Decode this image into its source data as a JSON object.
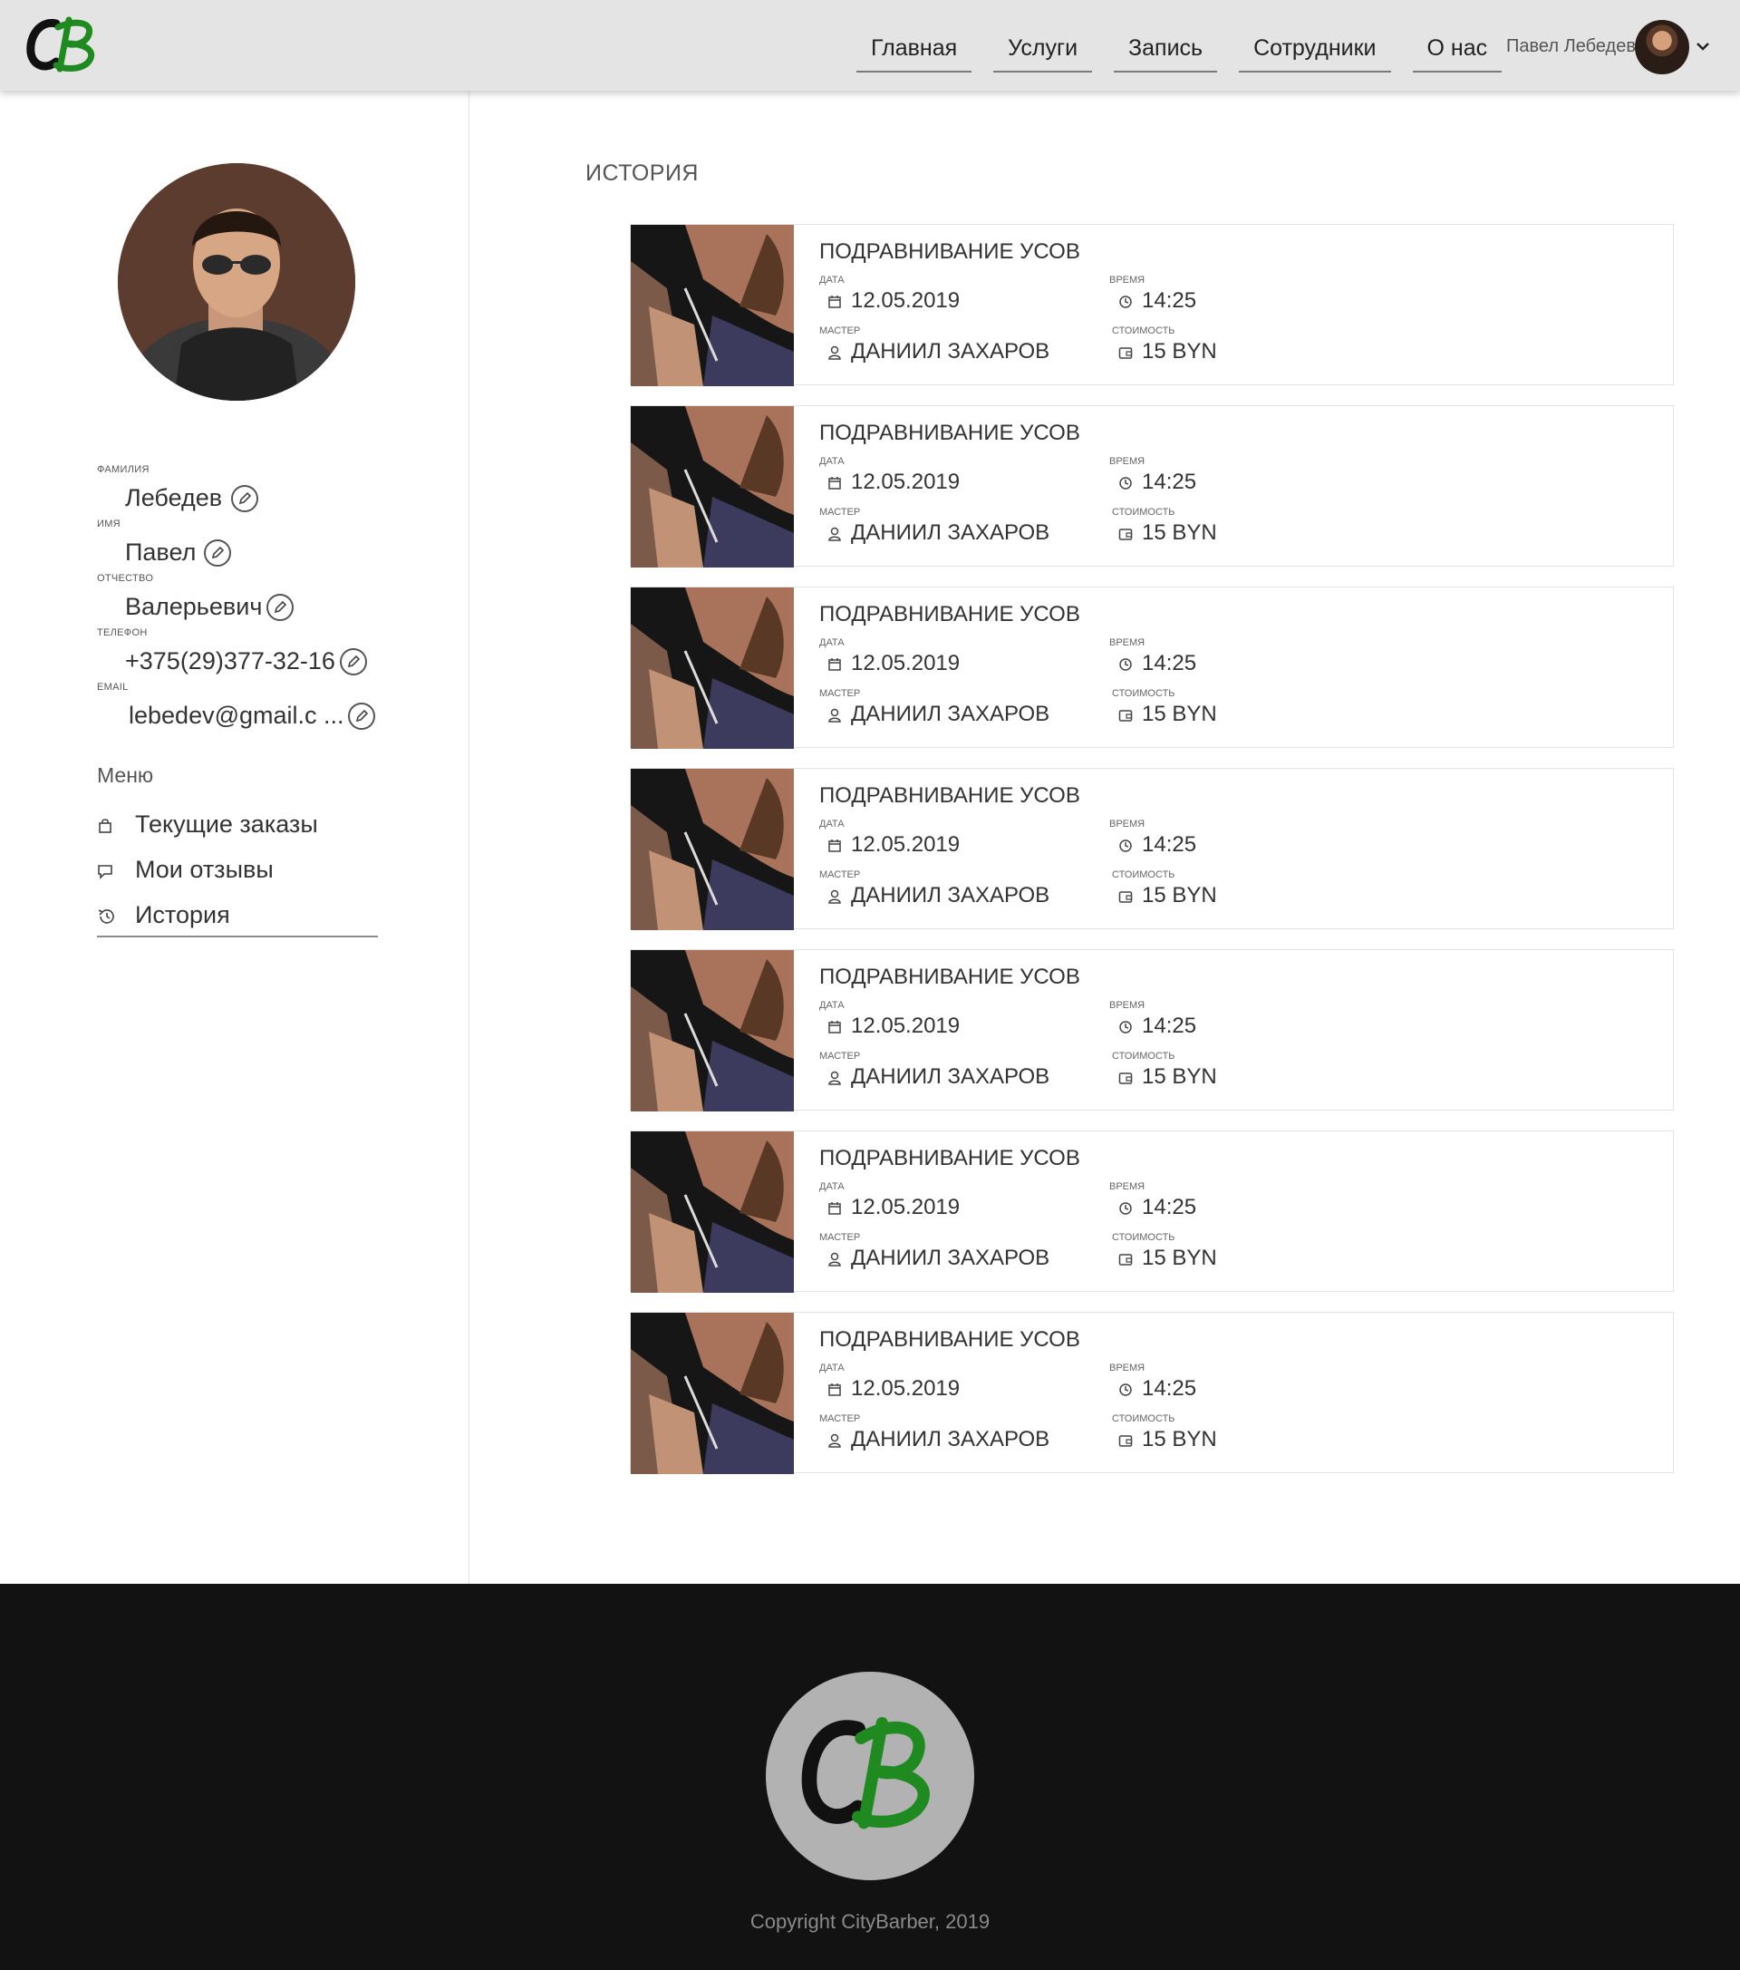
{
  "header": {
    "logo_text": "CB",
    "nav": [
      "Главная",
      "Услуги",
      "Запись",
      "Сотрудники",
      "О нас"
    ],
    "user_name": "Павел Лебедев"
  },
  "profile": {
    "fields": [
      {
        "label": "Фамилия",
        "value": "Лебедев"
      },
      {
        "label": "Имя",
        "value": "Павел"
      },
      {
        "label": "Отчество",
        "value": "Валерьевич"
      },
      {
        "label": "Телефон",
        "value": "+375(29)377-32-16"
      },
      {
        "label": "Email",
        "value": "lebedev@gmail.c ..."
      }
    ],
    "menu_title": "Меню",
    "menu": [
      {
        "label": "Текущие заказы",
        "icon": "bag-icon"
      },
      {
        "label": "Мои отзывы",
        "icon": "comment-icon"
      },
      {
        "label": "История",
        "icon": "history-icon"
      }
    ]
  },
  "history": {
    "title": "ИСТОРИЯ",
    "labels": {
      "date": "ДАТА",
      "time": "ВРЕМЯ",
      "master": "МАСТЕР",
      "price": "СТОИМОСТЬ"
    },
    "orders": [
      {
        "service": "ПОДРАВНИВАНИЕ УСОВ",
        "date": "12.05.2019",
        "time": "14:25",
        "master": "ДАНИИЛ ЗАХАРОВ",
        "price": "15 BYN"
      },
      {
        "service": "ПОДРАВНИВАНИЕ УСОВ",
        "date": "12.05.2019",
        "time": "14:25",
        "master": "ДАНИИЛ ЗАХАРОВ",
        "price": "15 BYN"
      },
      {
        "service": "ПОДРАВНИВАНИЕ УСОВ",
        "date": "12.05.2019",
        "time": "14:25",
        "master": "ДАНИИЛ ЗАХАРОВ",
        "price": "15 BYN"
      },
      {
        "service": "ПОДРАВНИВАНИЕ УСОВ",
        "date": "12.05.2019",
        "time": "14:25",
        "master": "ДАНИИЛ ЗАХАРОВ",
        "price": "15 BYN"
      },
      {
        "service": "ПОДРАВНИВАНИЕ УСОВ",
        "date": "12.05.2019",
        "time": "14:25",
        "master": "ДАНИИЛ ЗАХАРОВ",
        "price": "15 BYN"
      },
      {
        "service": "ПОДРАВНИВАНИЕ УСОВ",
        "date": "12.05.2019",
        "time": "14:25",
        "master": "ДАНИИЛ ЗАХАРОВ",
        "price": "15 BYN"
      },
      {
        "service": "ПОДРАВНИВАНИЕ УСОВ",
        "date": "12.05.2019",
        "time": "14:25",
        "master": "ДАНИИЛ ЗАХАРОВ",
        "price": "15 BYN"
      }
    ]
  },
  "footer": {
    "copyright": "Copyright CityBarber, 2019"
  },
  "colors": {
    "brand_green": "#1f8a1f",
    "footer_bg": "#121212",
    "header_bg": "#e4e4e4"
  }
}
